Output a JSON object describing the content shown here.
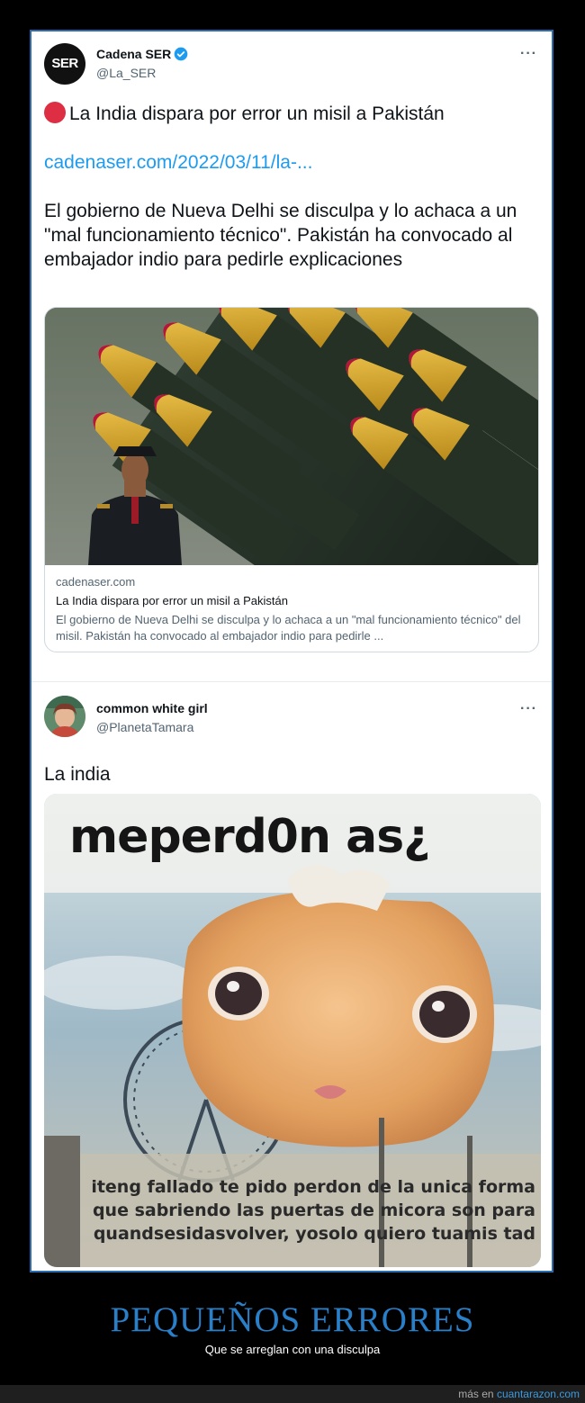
{
  "tweet1": {
    "name": "Cadena SER",
    "handle": "@La_SER",
    "avatar_text": "SER",
    "headline": "La India dispara por error un misil a Pakistán",
    "link": "cadenaser.com/2022/03/11/la-...",
    "body": "El gobierno de Nueva Delhi se disculpa y lo achaca a un \"mal funcionamiento técnico\". Pakistán ha convocado al embajador indio para pedirle explicaciones",
    "card": {
      "domain": "cadenaser.com",
      "title": "La India dispara por error un misil a Pakistán",
      "description": "El gobierno de Nueva Delhi se disculpa y lo achaca a un \"mal funcionamiento técnico\" del misil. Pakistán ha convocado al embajador indio para pedirle ..."
    }
  },
  "tweet2": {
    "name": "common white girl",
    "handle": "@PlanetaTamara",
    "body": "La india",
    "meme_top": "meperd0n as¿",
    "meme_bottom": "iteng fallado te pido perdon de la unica forma\nque sabriendo las puertas de micora son para\nquandsesidasvolver, yosolo quiero tuamis tad"
  },
  "more_label": "···",
  "caption": {
    "title": "PEQUEÑOS ERRORES",
    "subtitle": "Que se arreglan con una disculpa"
  },
  "footer": {
    "prefix": "más en",
    "site": "cuantarazon.com"
  },
  "colors": {
    "accent": "#2a7fc9",
    "link": "#1d9bf0",
    "verified": "#1d9bf0"
  }
}
